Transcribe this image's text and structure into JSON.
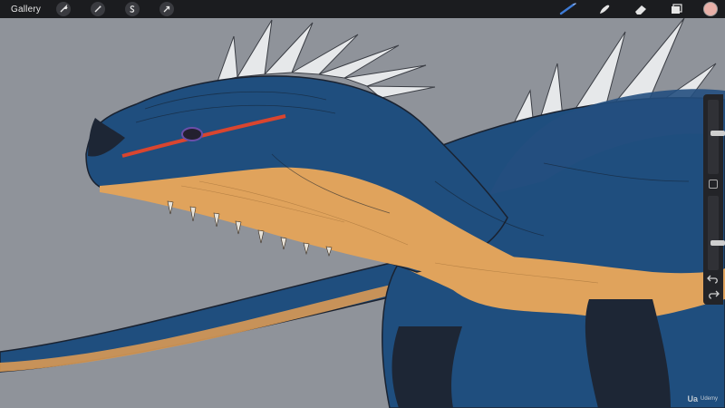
{
  "app": {
    "gallery_label": "Gallery"
  },
  "toolbar_left": [
    {
      "icon": "wrench-icon"
    },
    {
      "icon": "magic-wand-icon"
    },
    {
      "icon": "selection-s-icon"
    },
    {
      "icon": "arrow-cursor-icon"
    }
  ],
  "toolbar_right": [
    {
      "icon": "brush-icon"
    },
    {
      "icon": "smudge-icon"
    },
    {
      "icon": "eraser-icon"
    },
    {
      "icon": "layers-icon"
    }
  ],
  "colors": {
    "toolbar_bg": "#1b1c1f",
    "canvas_bg": "#8f939a",
    "dragon_blue": "#1f4e7e",
    "dragon_orange": "#e0a35c",
    "dragon_dark": "#1d2635",
    "eye_stripe": "#d9452f",
    "accent_brush": "#3e7bd6",
    "active_color": "#e8b0a8"
  },
  "sidebar": {
    "brush_size": 0.55,
    "opacity": 0.35
  },
  "watermark": {
    "mark": "Ua",
    "word": "Udemy"
  }
}
